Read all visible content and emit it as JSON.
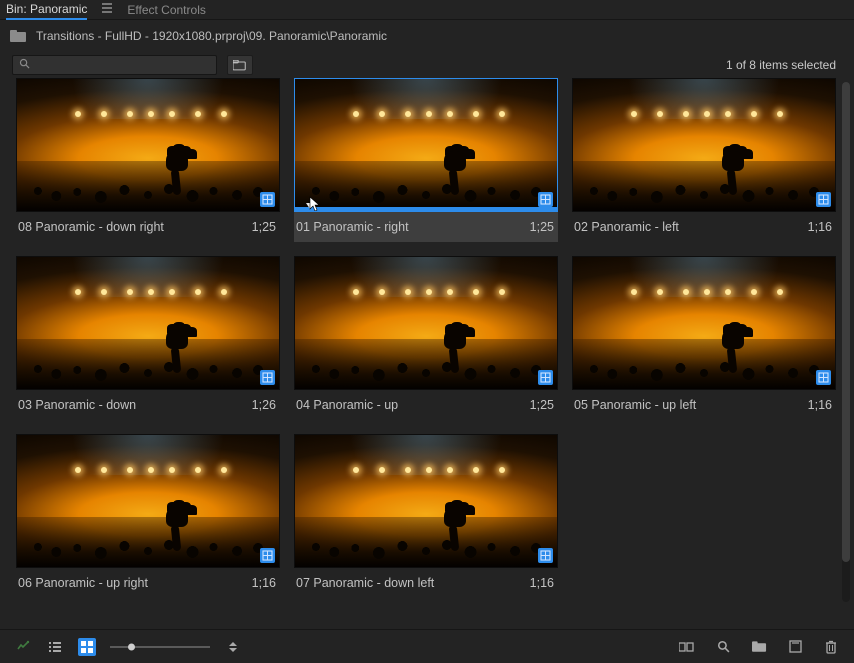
{
  "tabs": {
    "active": "Bin: Panoramic",
    "second": "Effect Controls"
  },
  "path": {
    "text": "Transitions - FullHD - 1920x1080.prproj\\09. Panoramic\\Panoramic"
  },
  "search": {
    "placeholder": ""
  },
  "selection": {
    "text": "1 of 8 items selected"
  },
  "clips": [
    {
      "name": "08 Panoramic - down right",
      "duration": "1;25",
      "selected": false
    },
    {
      "name": "01 Panoramic - right",
      "duration": "1;25",
      "selected": true
    },
    {
      "name": "02 Panoramic - left",
      "duration": "1;16",
      "selected": false
    },
    {
      "name": "03 Panoramic - down",
      "duration": "1;26",
      "selected": false
    },
    {
      "name": "04 Panoramic - up",
      "duration": "1;25",
      "selected": false
    },
    {
      "name": "05 Panoramic - up left",
      "duration": "1;16",
      "selected": false
    },
    {
      "name": "06 Panoramic - up right",
      "duration": "1;16",
      "selected": false
    },
    {
      "name": "07 Panoramic - down left",
      "duration": "1;16",
      "selected": false
    }
  ]
}
